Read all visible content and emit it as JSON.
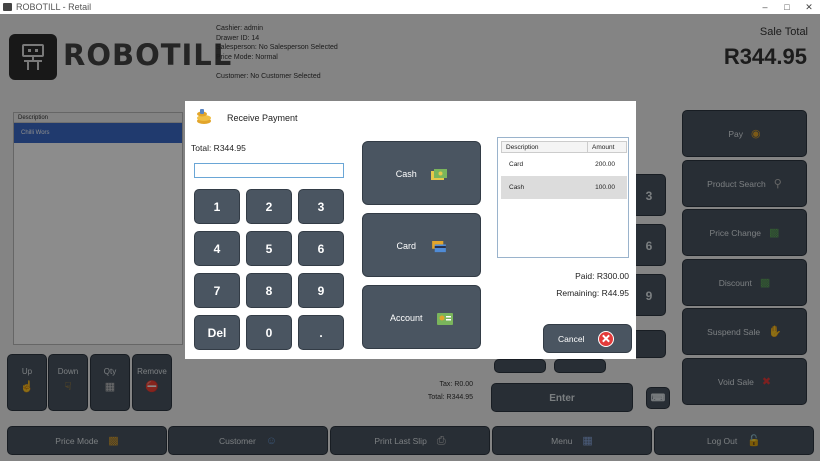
{
  "window": {
    "title": "ROBOTILL - Retail"
  },
  "header": {
    "logo_text": "ROBOTILL",
    "cashier": "Cashier: admin",
    "drawer": "Drawer ID: 14",
    "salesperson": "Salesperson: No Salesperson Selected",
    "price_mode": "Price Mode: Normal",
    "customer": "Customer: No Customer Selected",
    "sale_total_label": "Sale Total",
    "sale_total_value": "R344.95"
  },
  "items_grid": {
    "column_header": "Description",
    "rows": [
      "Chilli Wors"
    ]
  },
  "side_buttons": [
    {
      "label": "Up"
    },
    {
      "label": "Down"
    },
    {
      "label": "Qty"
    },
    {
      "label": "Remove"
    }
  ],
  "right_buttons": [
    {
      "label": "Pay"
    },
    {
      "label": "Product Search"
    },
    {
      "label": "Price Change"
    },
    {
      "label": "Discount"
    },
    {
      "label": "Suspend Sale"
    },
    {
      "label": "Void Sale"
    }
  ],
  "bottom_buttons": [
    {
      "label": "Price Mode"
    },
    {
      "label": "Customer"
    },
    {
      "label": "Print Last Slip"
    },
    {
      "label": "Menu"
    },
    {
      "label": "Log Out"
    }
  ],
  "background_keypad": {
    "enter_label": "Enter",
    "digits": [
      "3",
      "6",
      "9"
    ]
  },
  "totals": {
    "tax": "Tax: R0.00",
    "total": "Total: R344.95"
  },
  "dialog": {
    "title": "Receive Payment",
    "total": "Total: R344.95",
    "input_value": "",
    "keypad": [
      "1",
      "2",
      "3",
      "4",
      "5",
      "6",
      "7",
      "8",
      "9",
      "Del",
      "0",
      "."
    ],
    "payment_buttons": [
      {
        "label": "Cash"
      },
      {
        "label": "Card"
      },
      {
        "label": "Account"
      }
    ],
    "payments_table": {
      "headers": [
        "Description",
        "Amount"
      ],
      "rows": [
        {
          "description": "Card",
          "amount": "200.00"
        },
        {
          "description": "Cash",
          "amount": "100.00"
        }
      ]
    },
    "paid": "Paid: R300.00",
    "remaining": "Remaining: R44.95",
    "cancel_label": "Cancel"
  }
}
